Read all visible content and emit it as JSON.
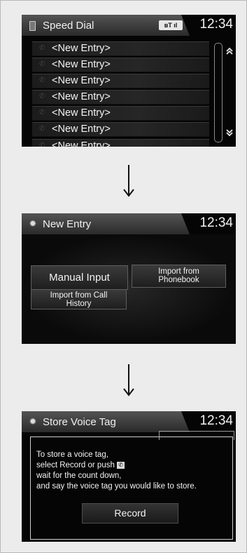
{
  "speed_dial": {
    "title": "Speed Dial",
    "clock": "12:34",
    "status": "ʙT📶",
    "entries": [
      "<New Entry>",
      "<New Entry>",
      "<New Entry>",
      "<New Entry>",
      "<New Entry>",
      "<New Entry>",
      "<New Entry>"
    ],
    "scroll_up": "⌃",
    "scroll_down": "⌄"
  },
  "new_entry": {
    "title": "New Entry",
    "clock": "12:34",
    "manual_input": "Manual Input",
    "import_phonebook_line1": "Import from",
    "import_phonebook_line2": "Phonebook",
    "import_call_line1": "Import from Call",
    "import_call_line2": "History"
  },
  "voice_tag": {
    "title": "Store Voice Tag",
    "clock": "12:34",
    "line1": "To store a voice tag,",
    "line2_pre": "select Record or push",
    "line3": "wait for the count down,",
    "line4": "and say the voice tag you would like to store.",
    "record": "Record"
  }
}
